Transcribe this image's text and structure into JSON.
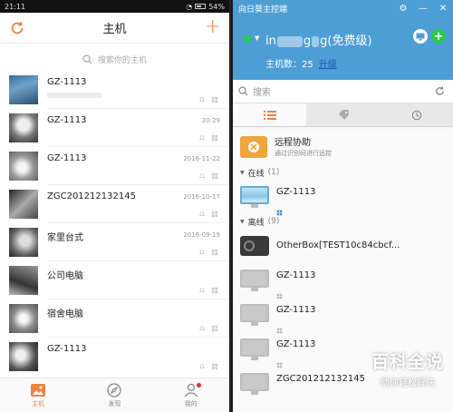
{
  "phone": {
    "status": {
      "time": "21:11",
      "battery": "54%"
    },
    "header": {
      "title": "主机"
    },
    "search": {
      "placeholder": "搜索你的主机"
    },
    "hosts": [
      {
        "name": "GZ-1113",
        "date": ""
      },
      {
        "name": "GZ-1113",
        "date": "20:29"
      },
      {
        "name": "GZ-1113",
        "date": "2016-11-22"
      },
      {
        "name": "ZGC201212132145",
        "date": "2016-10-17"
      },
      {
        "name": "家里台式",
        "date": "2016-09-19"
      },
      {
        "name": "公司电脑",
        "date": ""
      },
      {
        "name": "宿舍电脑",
        "date": ""
      },
      {
        "name": "GZ-1113",
        "date": ""
      }
    ],
    "tabbar": {
      "hosts": "主机",
      "discover": "发现",
      "mine": "我的"
    }
  },
  "client": {
    "title": "向日葵主控端",
    "user": {
      "prefix": "in",
      "mid": "g",
      "suffix": "g(免费级)"
    },
    "host_count": "主机数：25",
    "upgrade": "升级",
    "search": {
      "label": "搜索"
    },
    "assist": {
      "title": "远程协助",
      "subtitle": "通过识别码进行远控"
    },
    "groups": {
      "online": {
        "label": "在线",
        "count": "(1)"
      },
      "offline": {
        "label": "离线",
        "count": "(9)"
      }
    },
    "online_hosts": [
      {
        "name": "GZ-1113"
      }
    ],
    "offline_hosts": [
      {
        "name": "OtherBox[TEST10c84cbcf..."
      },
      {
        "name": "GZ-1113"
      },
      {
        "name": "GZ-1113"
      },
      {
        "name": "GZ-1113"
      },
      {
        "name": "ZGC201212132145"
      }
    ],
    "colors": {
      "titlebar": "#4e9ed6",
      "online": "#2ec84a",
      "accent": "#f08040"
    }
  },
  "watermark": {
    "line1": "百科全说",
    "line2": "助你轻松解决"
  }
}
